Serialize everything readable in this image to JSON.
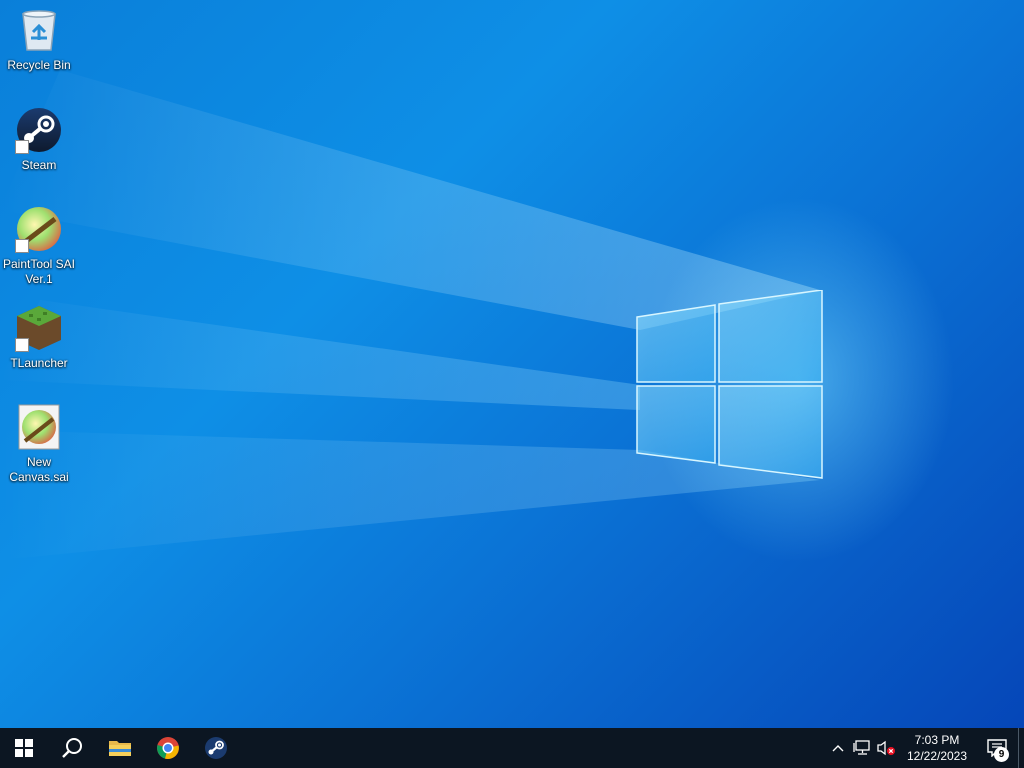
{
  "desktop": {
    "icons": [
      {
        "label": "Recycle Bin",
        "icon": "recycle-bin-icon"
      },
      {
        "label": "Steam",
        "icon": "steam-icon"
      },
      {
        "label": "PaintTool SAI Ver.1",
        "icon": "painttool-sai-icon"
      },
      {
        "label": "TLauncher",
        "icon": "tlauncher-icon"
      },
      {
        "label": "New Canvas.sai",
        "icon": "sai-file-icon"
      }
    ]
  },
  "taskbar": {
    "start": {
      "icon": "windows-start-icon"
    },
    "search": {
      "icon": "search-icon"
    },
    "pinned": [
      {
        "name": "File Explorer",
        "icon": "file-explorer-icon"
      },
      {
        "name": "Google Chrome",
        "icon": "chrome-icon"
      },
      {
        "name": "Steam",
        "icon": "steam-icon"
      }
    ],
    "tray": {
      "chevron_icon": "chevron-up-icon",
      "network_icon": "network-icon",
      "volume_icon": "volume-muted-icon",
      "time": "7:03 PM",
      "date": "12/22/2023",
      "notification_count": "9",
      "notification_icon": "notification-center-icon"
    }
  },
  "colors": {
    "taskbar_bg": "#0c1622",
    "wallpaper_primary": "#0b74d6",
    "logo_glow": "#7fdcff"
  }
}
